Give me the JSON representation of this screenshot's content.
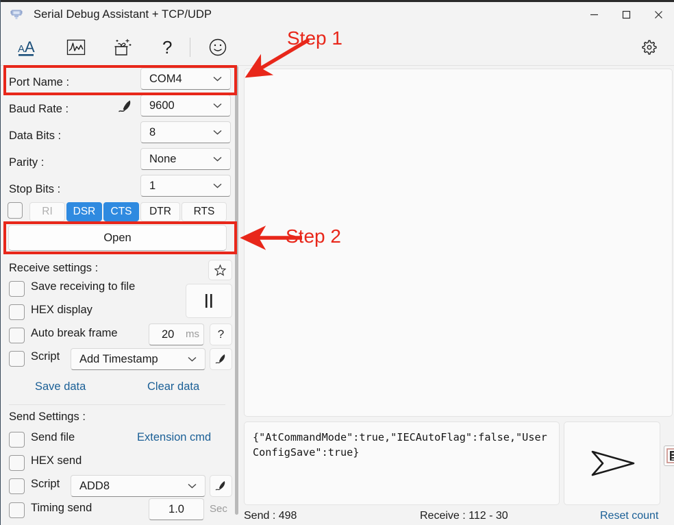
{
  "window": {
    "title": "Serial Debug Assistant + TCP/UDP",
    "icon": "serial-device-icon",
    "minimize": "minimize-icon",
    "maximize": "maximize-icon",
    "close": "close-icon"
  },
  "toolbar": {
    "items": [
      {
        "name": "font-size-icon",
        "label": "AA"
      },
      {
        "name": "waveform-chart-icon",
        "label": ""
      },
      {
        "name": "gift-box-icon",
        "label": ""
      },
      {
        "name": "help-question-icon",
        "label": "?"
      },
      {
        "name": "smiley-face-icon",
        "label": ""
      }
    ],
    "settings_icon": "gear-icon"
  },
  "serial": {
    "fields": [
      {
        "label": "Port Name :",
        "value": "COM4"
      },
      {
        "label": "Baud Rate :",
        "value": "9600"
      },
      {
        "label": "Data Bits :",
        "value": "8"
      },
      {
        "label": "Parity :",
        "value": "None"
      },
      {
        "label": "Stop Bits :",
        "value": "1"
      }
    ],
    "baud_edit_icon": "quill-pen-icon",
    "signals": [
      {
        "label": "RI",
        "state": "dim"
      },
      {
        "label": "DSR",
        "state": "on"
      },
      {
        "label": "CTS",
        "state": "on"
      },
      {
        "label": "DTR",
        "state": "off"
      },
      {
        "label": "RTS",
        "state": "off"
      }
    ],
    "signal_checkbox": "signal-master-checkbox",
    "open_button": "Open"
  },
  "receive_settings": {
    "title": "Receive settings :",
    "favorite_icon": "star-icon",
    "pause_icon": "pause-icon",
    "checkboxes": [
      {
        "label": "Save receiving to file",
        "checked": false
      },
      {
        "label": "HEX display",
        "checked": false
      },
      {
        "label": "Auto break frame",
        "checked": false
      },
      {
        "label": "Script",
        "checked": false
      }
    ],
    "break_frame_value": "20",
    "break_frame_unit": "ms",
    "help_icon": "?",
    "script_value": "Add Timestamp",
    "script_edit_icon": "quill-pen-icon",
    "save_data": "Save data",
    "clear_data": "Clear data"
  },
  "send_settings": {
    "title": "Send Settings :",
    "extension_cmd": "Extension cmd",
    "checkboxes": [
      {
        "label": "Send file",
        "checked": false
      },
      {
        "label": "HEX send",
        "checked": false
      },
      {
        "label": "Script",
        "checked": false
      },
      {
        "label": "Timing send",
        "checked": false
      }
    ],
    "script_value": "ADD8",
    "script_edit_icon": "quill-pen-icon",
    "timing_value": "1.0",
    "timing_unit": "Sec"
  },
  "receive_area": {
    "content": ""
  },
  "send_area": {
    "content": "{\"AtCommandMode\":true,\"IECAutoFlag\":false,\"UserConfigSave\":true}",
    "send_icon": "send-arrow-icon",
    "lang_icon": "chinese-lang-icon"
  },
  "statusbar": {
    "send_count": "Send : 498",
    "receive_count": "Receive : 112 - 30",
    "reset": "Reset count"
  },
  "annotations": {
    "step1": "Step 1",
    "step2": "Step 2",
    "color": "#e8271a"
  }
}
